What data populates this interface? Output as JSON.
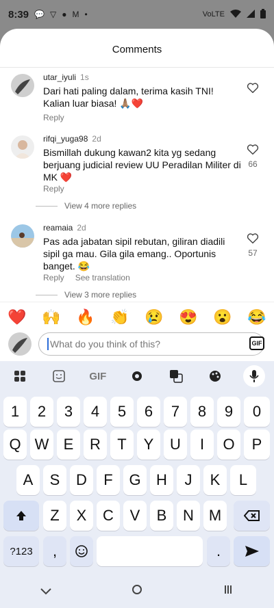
{
  "status": {
    "time": "8:39",
    "icons": [
      "chat-icon",
      "v-icon",
      "snapchat-icon",
      "m-icon",
      "dot-icon"
    ],
    "net": "VoLTE"
  },
  "sheet": {
    "title": "Comments"
  },
  "comments": [
    {
      "username": "utar_iyuli",
      "time": "1s",
      "text": "Dari hati paling dalam, terima kasih TNI! Kalian luar biasa! 🙏🏽❤️",
      "reply": "Reply",
      "likes": ""
    },
    {
      "username": "rifqi_yuga98",
      "time": "2d",
      "text": "Bismillah dukung kawan2 kita yg sedang berjuang judicial review UU Peradilan Militer di MK ❤️",
      "reply": "Reply",
      "likes": "66",
      "more": "View 4 more replies"
    },
    {
      "username": "reamaia",
      "time": "2d",
      "text": "Pas ada jabatan sipil rebutan, giliran diadili sipil ga mau. Gila gila emang.. Oportunis banget. 😂",
      "reply": "Reply",
      "translate": "See translation",
      "likes": "57",
      "more": "View 3 more replies"
    }
  ],
  "reactions": [
    "❤️",
    "🙌",
    "🔥",
    "👏",
    "😢",
    "😍",
    "😮",
    "😂"
  ],
  "composer": {
    "placeholder": "What do you think of this?",
    "gif_label": "GIF"
  },
  "keyboard": {
    "toolbar": [
      "apps-icon",
      "sticker-icon",
      "GIF",
      "settings-icon",
      "translate-icon",
      "palette-icon",
      "mic-icon"
    ],
    "gif_label": "GIF",
    "row_numbers": [
      "1",
      "2",
      "3",
      "4",
      "5",
      "6",
      "7",
      "8",
      "9",
      "0"
    ],
    "row1": [
      "Q",
      "W",
      "E",
      "R",
      "T",
      "Y",
      "U",
      "I",
      "O",
      "P"
    ],
    "row2": [
      "A",
      "S",
      "D",
      "F",
      "G",
      "H",
      "J",
      "K",
      "L"
    ],
    "row3": [
      "Z",
      "X",
      "C",
      "V",
      "B",
      "N",
      "M"
    ],
    "symbols_label": "?123",
    "comma": ",",
    "period": "."
  },
  "colors": {
    "accent": "#2b6cd8",
    "keyboard_bg": "#e9edf6"
  }
}
